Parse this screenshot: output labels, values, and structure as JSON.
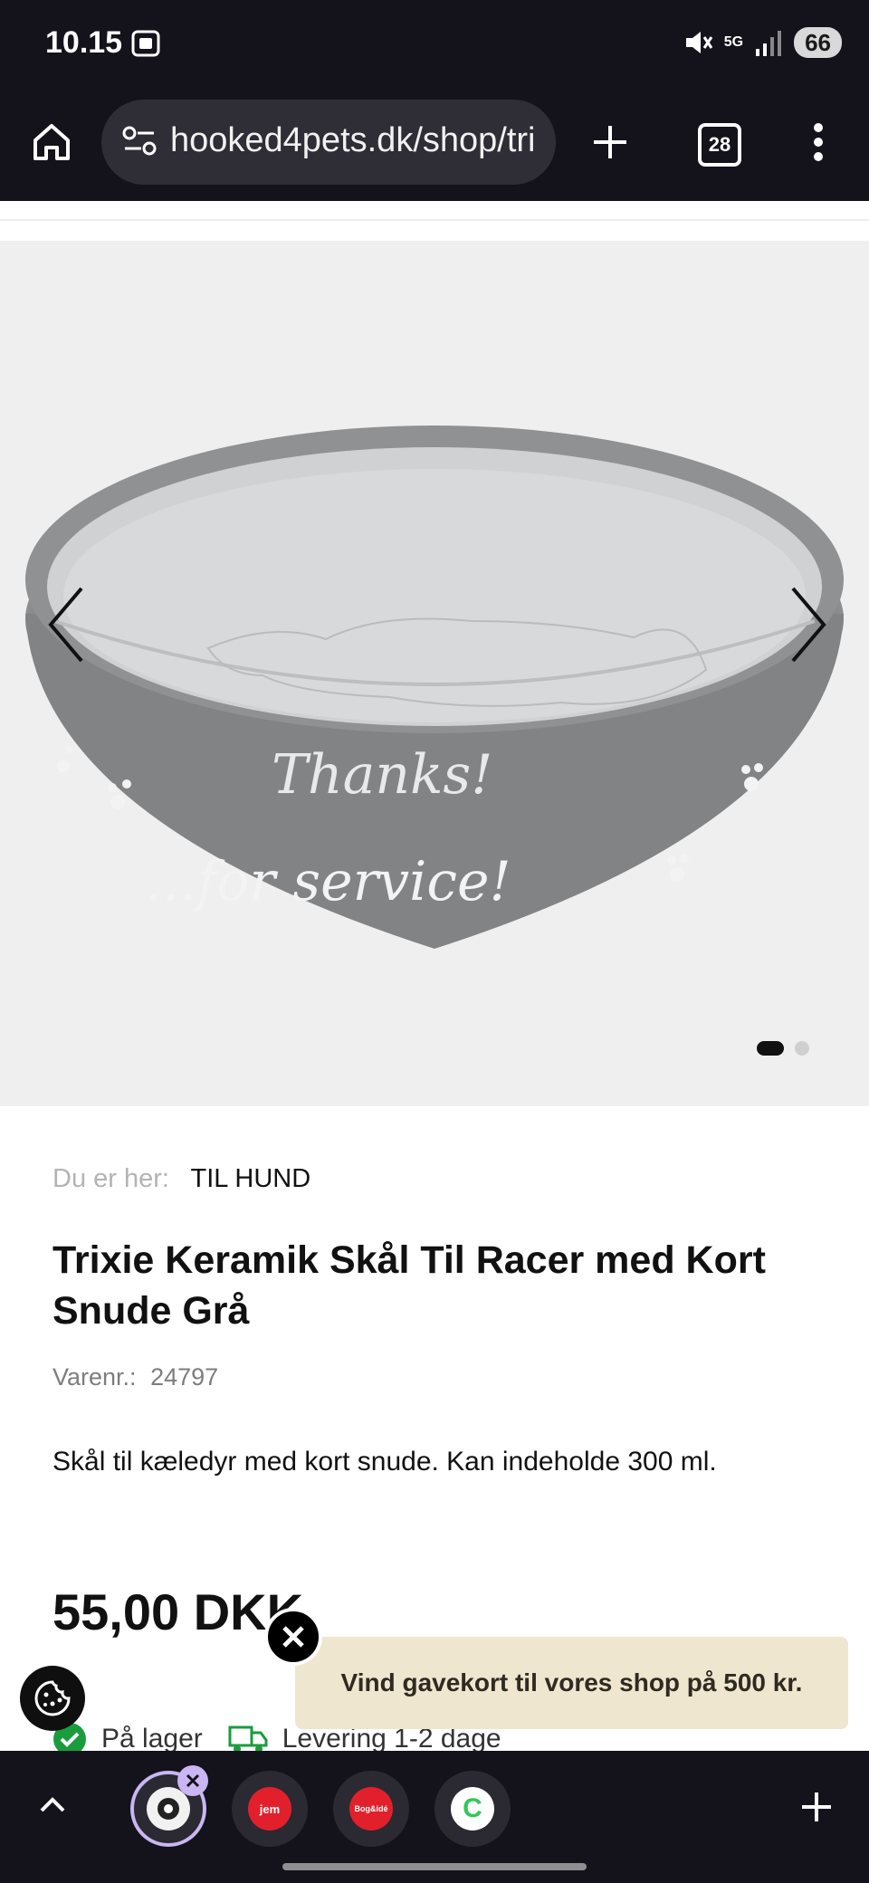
{
  "status": {
    "time": "10.15",
    "network": "5G",
    "battery": "66"
  },
  "browser": {
    "url": "hooked4pets.dk/shop/tri",
    "tab_count": "28"
  },
  "gallery": {
    "image_text_1": "Thanks!",
    "image_text_2": "...for service!",
    "active_index": 1,
    "total": 2
  },
  "product": {
    "breadcrumb_label": "Du er her:",
    "breadcrumb_link": "TIL HUND",
    "title": "Trixie Keramik Skål Til Racer med Kort Snude Grå",
    "sku_label": "Varenr.:",
    "sku": "24797",
    "description": "Skål til kæledyr med kort snude. Kan indeholde 300 ml.",
    "price": "55,00 DKK",
    "stock": "På lager",
    "delivery": "Levering 1-2 dage"
  },
  "promo": {
    "text": "Vind gavekort til vores shop på 500 kr."
  },
  "bottom_tabs": [
    {
      "label": "",
      "color": "#f1f1f1"
    },
    {
      "label": "jem",
      "color": "#e2202c"
    },
    {
      "label": "Bog&idé",
      "color": "#e2202c"
    },
    {
      "label": "C",
      "color": "#34c759"
    }
  ],
  "colors": {
    "browser_chrome": "#14121a",
    "hero_bg": "#efefef",
    "promo_bg": "#efe6cf",
    "check_green": "#1a9c3d"
  }
}
